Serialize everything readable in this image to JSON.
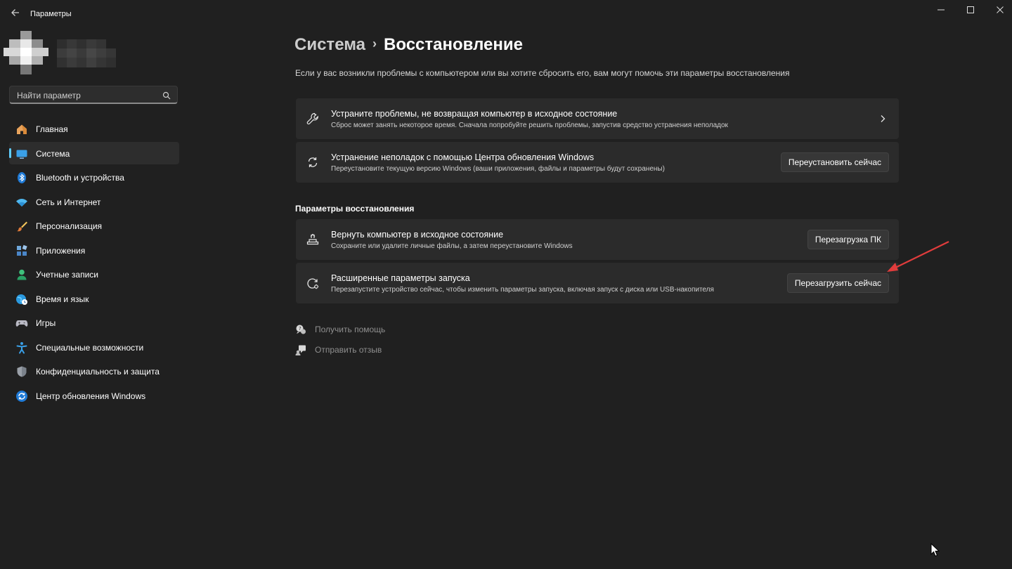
{
  "window": {
    "title": "Параметры",
    "controls": [
      "minimize-icon",
      "maximize-icon",
      "close-icon"
    ]
  },
  "search": {
    "placeholder": "Найти параметр"
  },
  "nav": [
    {
      "label": "Главная",
      "icon": "home-icon"
    },
    {
      "label": "Система",
      "icon": "system-icon",
      "active": true
    },
    {
      "label": "Bluetooth и устройства",
      "icon": "bluetooth-icon"
    },
    {
      "label": "Сеть и Интернет",
      "icon": "wifi-icon"
    },
    {
      "label": "Персонализация",
      "icon": "brush-icon"
    },
    {
      "label": "Приложения",
      "icon": "apps-icon"
    },
    {
      "label": "Учетные записи",
      "icon": "accounts-icon"
    },
    {
      "label": "Время и язык",
      "icon": "globe-clock-icon"
    },
    {
      "label": "Игры",
      "icon": "gamepad-icon"
    },
    {
      "label": "Специальные возможности",
      "icon": "accessibility-icon"
    },
    {
      "label": "Конфиденциальность и защита",
      "icon": "shield-icon"
    },
    {
      "label": "Центр обновления Windows",
      "icon": "update-icon"
    }
  ],
  "breadcrumb": {
    "parent": "Система",
    "separator": "›",
    "current": "Восстановление"
  },
  "page_description": "Если у вас возникли проблемы с компьютером или вы хотите сбросить его, вам могут помочь эти параметры восстановления",
  "cards_top": [
    {
      "title": "Устраните проблемы, не возвращая компьютер в исходное состояние",
      "subtitle": "Сброс может занять некоторое время. Сначала попробуйте решить проблемы, запустив средство устранения неполадок",
      "icon": "wrench-icon"
    },
    {
      "title": "Устранение неполадок с помощью Центра обновления Windows",
      "subtitle": "Переустановите текущую версию Windows (ваши приложения, файлы и параметры будут сохранены)",
      "button": "Переустановить сейчас",
      "icon": "refresh-icon"
    }
  ],
  "section_title": "Параметры восстановления",
  "cards_recovery": [
    {
      "title": "Вернуть компьютер в исходное состояние",
      "subtitle": "Сохраните или удалите личные файлы, а затем переустановите Windows",
      "button": "Перезагрузка ПК",
      "icon": "reset-pc-icon"
    },
    {
      "title": "Расширенные параметры запуска",
      "subtitle": "Перезапустите устройство сейчас, чтобы изменить параметры запуска, включая запуск с диска или USB-накопителя",
      "button": "Перезагрузить сейчас",
      "icon": "advanced-startup-icon"
    }
  ],
  "help_links": [
    {
      "label": "Получить помощь",
      "icon": "help-chat-icon"
    },
    {
      "label": "Отправить отзыв",
      "icon": "feedback-icon"
    }
  ],
  "colors": {
    "background": "#202020",
    "card": "#2b2b2b",
    "accent": "#60cdff",
    "annotation": "#e03c3c"
  }
}
